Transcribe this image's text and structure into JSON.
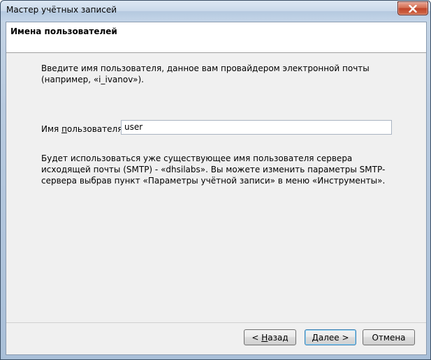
{
  "window": {
    "title": "Мастер учётных записей"
  },
  "header": {
    "title": "Имена пользователей"
  },
  "content": {
    "intro": "Введите имя пользователя, данное вам провайдером электронной почты (например, «i_ivanov»).",
    "username_label_prefix": "Имя ",
    "username_label_access": "п",
    "username_label_suffix": "ользователя:",
    "username_value": "user",
    "info": "Будет использоваться уже существующее имя пользователя сервера исходящей почты (SMTP) - «dhsilabs». Вы можете изменить параметры SMTP-сервера выбрав пункт «Параметры учётной записи» в меню «Инструменты»."
  },
  "buttons": {
    "back_prefix": "< ",
    "back_access": "Н",
    "back_suffix": "азад",
    "next_access": "Д",
    "next_suffix": "алее >",
    "cancel": "Отмена"
  },
  "icons": {
    "close": "close-icon"
  }
}
